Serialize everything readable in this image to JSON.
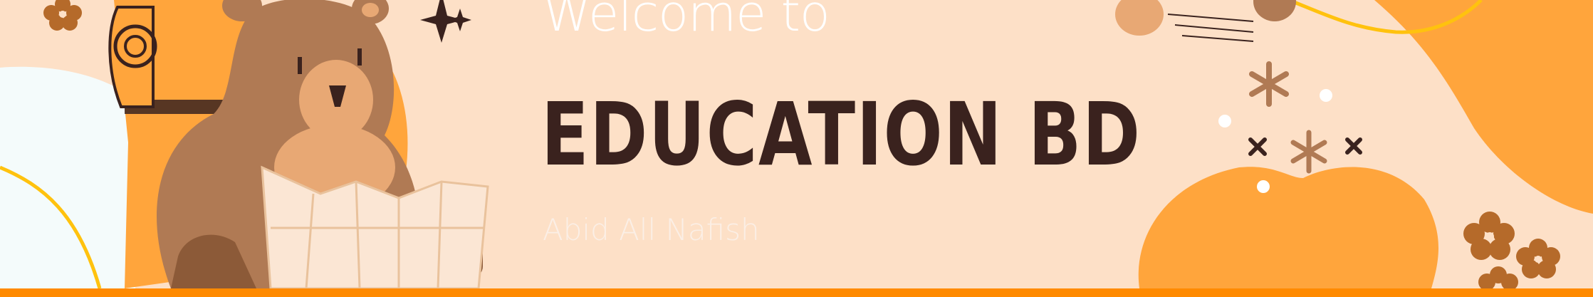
{
  "banner": {
    "welcome_text": "Welcome to",
    "title": "EDUCATION BD",
    "author": "Abid All Nafish"
  },
  "colors": {
    "background": "#fde0c7",
    "orange": "#ffa53c",
    "bottom_bar": "#ff8a00",
    "dark_brown": "#3a221e",
    "brown": "#b07a54"
  },
  "icons": [
    "bear-illustration",
    "backpack",
    "map",
    "sparkle-icon",
    "flower-icon",
    "asterisk-icon",
    "cross-icon",
    "mushroom-illustration"
  ]
}
